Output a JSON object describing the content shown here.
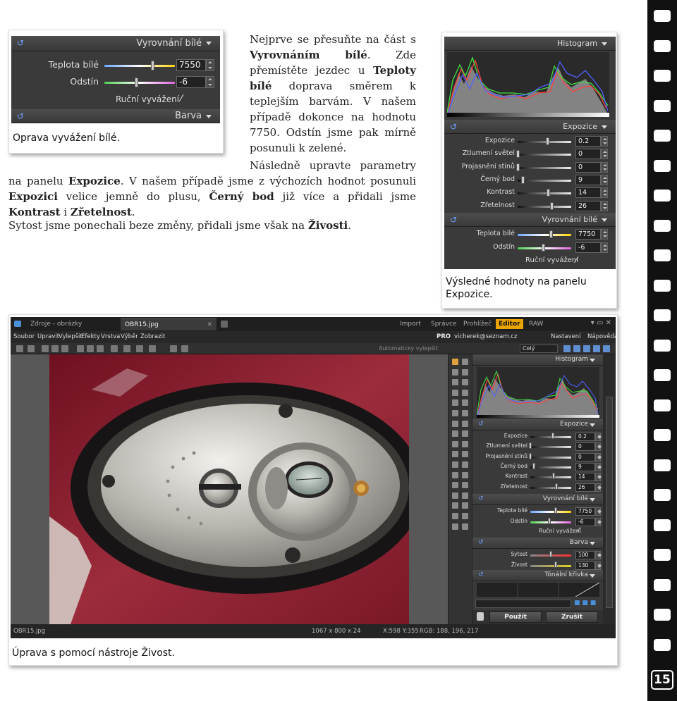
{
  "page_number": "15",
  "top_left": {
    "panel_white": {
      "title": "Vyrovnání bílé",
      "temp_label": "Teplota bílé",
      "temp_value": "7550",
      "tint_label": "Odstín",
      "tint_value": "-6",
      "manual_label": "Ruční vyvážení"
    },
    "panel_color_title": "Barva",
    "caption": "Oprava vyvážení bílé."
  },
  "text": {
    "p1": [
      {
        "t": "Nejprve se přesuňte na část s ",
        "b": false
      },
      {
        "t": "Vyrovnáním bílé",
        "b": true
      },
      {
        "t": ". Zde přemístěte jezdec u ",
        "b": false
      },
      {
        "t": "Teploty bílé",
        "b": true
      },
      {
        "t": " doprava směrem k teplejším barvám. V našem případě dokonce na hodnotu 7750. Odstín jsme pak mírně posunuli k zelené.",
        "b": false
      }
    ],
    "p2": [
      {
        "t": "Následně upravte parametry na panelu ",
        "b": false
      },
      {
        "t": "Expozice",
        "b": true
      },
      {
        "t": ". V našem případě jsme z výchozích hodnot posunuli ",
        "b": false
      },
      {
        "t": "Expozici",
        "b": true
      },
      {
        "t": " velice jemně do plusu, ",
        "b": false
      },
      {
        "t": "Černý bod",
        "b": true
      },
      {
        "t": " již více a přidali jsme ",
        "b": false
      },
      {
        "t": "Kontrast",
        "b": true
      },
      {
        "t": " i ",
        "b": false
      },
      {
        "t": "Zřetelnost",
        "b": true
      },
      {
        "t": ".",
        "b": false
      }
    ],
    "p3": [
      {
        "t": "Sytost jsme ponechali beze změny, přidali jsme však na ",
        "b": false
      },
      {
        "t": "Živosti",
        "b": true
      },
      {
        "t": ".",
        "b": false
      }
    ]
  },
  "top_right": {
    "histogram_title": "Histogram",
    "exposure_title": "Expozice",
    "exposure_rows": [
      {
        "label": "Expozice",
        "value": "0.2",
        "pos": 0.55
      },
      {
        "label": "Ztlumení světel",
        "value": "0",
        "pos": 0.0
      },
      {
        "label": "Projasnění stínů",
        "value": "0",
        "pos": 0.0
      },
      {
        "label": "Černý bod",
        "value": "9",
        "pos": 0.09
      },
      {
        "label": "Kontrast",
        "value": "14",
        "pos": 0.57
      },
      {
        "label": "Zřetelnost",
        "value": "26",
        "pos": 0.63
      }
    ],
    "white_title": "Vyrovnání bílé",
    "white_rows": [
      {
        "label": "Teplota bílé",
        "value": "7750",
        "pos": 0.62
      },
      {
        "label": "Odstín",
        "value": "-6",
        "pos": 0.47
      }
    ],
    "manual_label": "Ruční vyvážení",
    "caption": "Výsledné hodnoty na panelu Expozice."
  },
  "editor": {
    "tabs": [
      "Zdroje - obrázky",
      "OBR15.jpg"
    ],
    "modes": [
      "Import",
      "Správce",
      "Prohlížeč",
      "Editor",
      "RAW"
    ],
    "active_mode": "Editor",
    "menu": [
      "Soubor",
      "Upravit",
      "Vylepšit",
      "Efekty",
      "Vrstva",
      "Výběr",
      "Zobrazit"
    ],
    "right_menu": [
      "Nastavení",
      "Nápověda"
    ],
    "pro": "PRO",
    "email": "vicherek@seznam.cz",
    "zoom": "Celý",
    "auto_enhance": "Automaticky vylepšit",
    "panel": {
      "histogram_title": "Histogram",
      "exposure_title": "Expozice",
      "exposure_rows": [
        {
          "label": "Expozice",
          "value": "0.2",
          "pos": 0.55
        },
        {
          "label": "Ztlumení světel",
          "value": "0",
          "pos": 0.0
        },
        {
          "label": "Projasnění stínů",
          "value": "0",
          "pos": 0.0
        },
        {
          "label": "Černý bod",
          "value": "9",
          "pos": 0.09
        },
        {
          "label": "Kontrast",
          "value": "14",
          "pos": 0.57
        },
        {
          "label": "Zřetelnost",
          "value": "26",
          "pos": 0.63
        }
      ],
      "white_title": "Vyrovnání bílé",
      "white_rows": [
        {
          "label": "Teplota bílé",
          "value": "7750",
          "pos": 0.62
        },
        {
          "label": "Odstín",
          "value": "-6",
          "pos": 0.47
        }
      ],
      "manual_label": "Ruční vyvážení",
      "color_title": "Barva",
      "color_rows": [
        {
          "label": "Sytost",
          "value": "100",
          "pos": 0.5
        },
        {
          "label": "Živost",
          "value": "130",
          "pos": 0.62
        }
      ],
      "curve_title": "Tónální křivka",
      "apply_label": "Použít",
      "cancel_label": "Zrušit"
    },
    "status": {
      "filename": "OBR15.jpg",
      "dimensions": "1067 x 800 x 24",
      "coords": "X:598 Y:355",
      "rgb": "RGB: 188, 196, 217"
    },
    "caption": "Úprava s pomocí nástroje Živost."
  },
  "colors": {
    "accent": "#e8a400",
    "panel_bg": "#3a3a3a",
    "photo_bg": "#8c2232"
  }
}
